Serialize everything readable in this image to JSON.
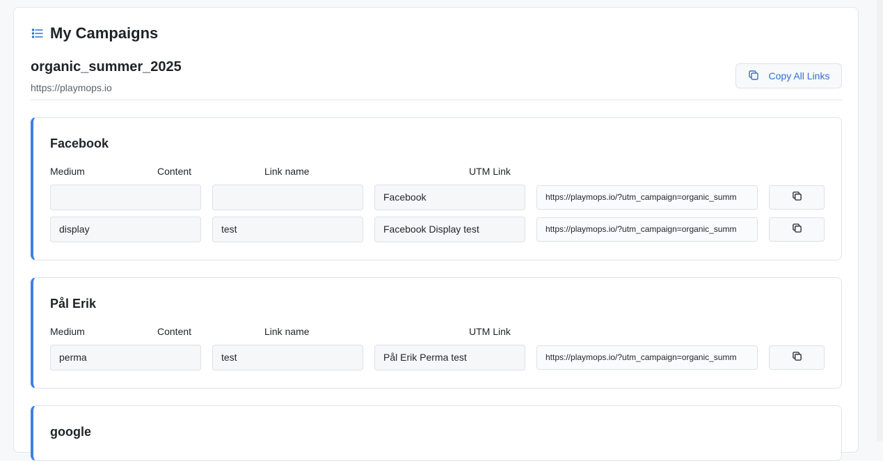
{
  "header": {
    "title": "My Campaigns"
  },
  "campaign": {
    "name": "organic_summer_2025",
    "url": "https://playmops.io",
    "copy_all_label": "Copy All Links"
  },
  "columns": {
    "medium": "Medium",
    "content": "Content",
    "link_name": "Link name",
    "utm_link": "UTM Link"
  },
  "groups": [
    {
      "title": "Facebook",
      "rows": [
        {
          "medium": "",
          "content": "",
          "link_name": "Facebook",
          "utm": "https://playmops.io/?utm_campaign=organic_summ"
        },
        {
          "medium": "display",
          "content": "test",
          "link_name": "Facebook Display test",
          "utm": "https://playmops.io/?utm_campaign=organic_summ"
        }
      ]
    },
    {
      "title": "Pål Erik",
      "rows": [
        {
          "medium": "perma",
          "content": "test",
          "link_name": "Pål Erik Perma test",
          "utm": "https://playmops.io/?utm_campaign=organic_summ"
        }
      ]
    },
    {
      "title": "google",
      "rows": []
    }
  ],
  "colors": {
    "accent": "#3f7fe6",
    "link": "#2f6fd6"
  }
}
